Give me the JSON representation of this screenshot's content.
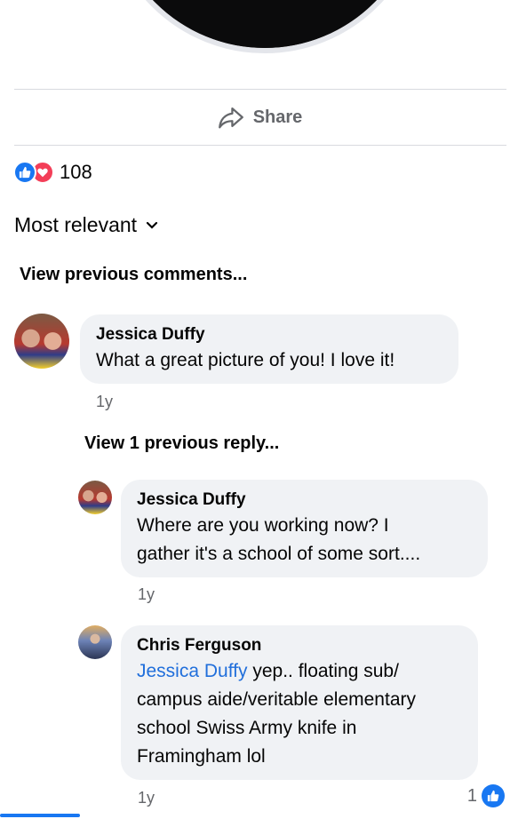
{
  "post": {
    "share_label": "Share",
    "reaction_count": "108",
    "reaction_icons": [
      "like-icon",
      "love-icon"
    ]
  },
  "comments_header": {
    "sort_label": "Most relevant",
    "view_previous": "View previous comments..."
  },
  "comments": [
    {
      "author": "Jessica Duffy",
      "text": "What a great picture of you! I love it!",
      "time": "1y"
    }
  ],
  "view_replies": "View 1 previous reply...",
  "replies": [
    {
      "author": "Jessica Duffy",
      "line1": "Where are you working now? I",
      "line2": "gather it's a school of some sort....",
      "time": "1y"
    },
    {
      "author": "Chris Ferguson",
      "mention": "Jessica Duffy",
      "line1": " yep.. floating sub/",
      "line2": "campus aide/veritable elementary",
      "line3": "school Swiss Army knife in",
      "line4": "Framingham lol",
      "time": "1y",
      "like_count": "1"
    }
  ],
  "colors": {
    "accent": "#1877f2",
    "love": "#f33e58",
    "bubble": "#f0f2f5",
    "mention": "#216fdb"
  }
}
